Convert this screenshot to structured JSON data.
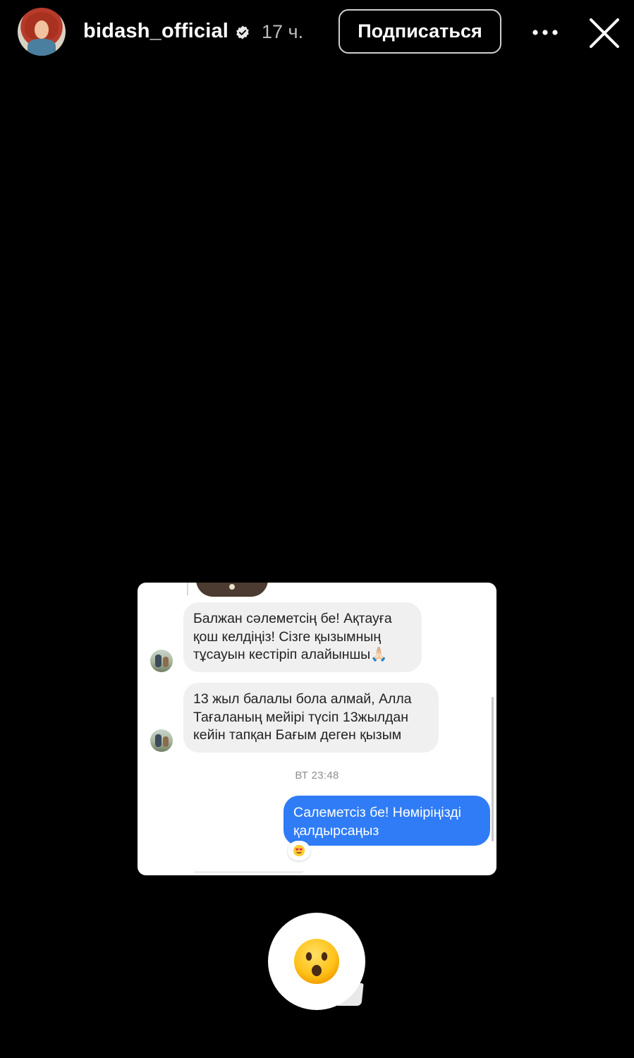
{
  "header": {
    "username": "bidash_official",
    "time": "17 ч.",
    "follow_label": "Подписаться",
    "icons": {
      "avatar": "profile-avatar",
      "verified": "verified-badge-icon",
      "more": "more-icon",
      "close": "close-icon"
    }
  },
  "chat": {
    "messages_in": [
      {
        "lines": [
          "Балжан сәлеметсің бе! Ақтауға",
          "қош келдіңіз! Сізге қызымның",
          "тұсауын кестіріп алайыншы🙏🏻"
        ]
      },
      {
        "lines": [
          "13 жыл балалы бола алмай, Алла",
          "Тағаланың мейірі түсіп 13жылдан",
          "кейін тапқан Бағым деген қызым"
        ]
      }
    ],
    "timestamp": "ВТ 23:48",
    "message_out": {
      "lines": [
        "Салеметсіз бе! Нөміріңізді",
        "қалдырсаңыз"
      ]
    },
    "reaction": "😍"
  },
  "sticker": {
    "emoji": "😮",
    "icon": "surprised-face-emoji"
  },
  "colors": {
    "background": "#000000",
    "outgoing_bubble": "#2f7cf6",
    "incoming_bubble": "#f0f0f0"
  }
}
